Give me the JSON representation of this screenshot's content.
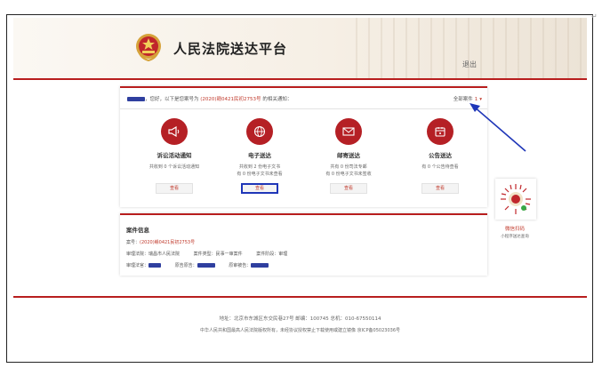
{
  "header": {
    "site_title": "人民法院送达平台",
    "logout_label": "退出"
  },
  "notice": {
    "greeting_suffix": "，您好，以下是您案号为",
    "case_number": "(2020)赣0421民初2753号",
    "notice_suffix": "的相关通知：",
    "total_files_label": "全部案件",
    "total_files_count": "1",
    "dropdown_icon": "caret-down-icon"
  },
  "services": [
    {
      "icon": "megaphone-icon",
      "title": "诉讼活动通知",
      "desc_lines": [
        "共收到 0 个诉讼活动通知"
      ],
      "button": "查看"
    },
    {
      "icon": "globe-icon",
      "title": "电子送达",
      "desc_lines": [
        "共收到 2 份电子文书",
        "有 0 份电子文书未查看"
      ],
      "button": "查看",
      "highlighted": true
    },
    {
      "icon": "mail-icon",
      "title": "邮寄送达",
      "desc_lines": [
        "共有 0 份司法专邮",
        "有 0 份电子文书未签收"
      ],
      "button": "查看"
    },
    {
      "icon": "announcement-icon",
      "title": "公告送达",
      "desc_lines": [
        "有 0 个公告待查看"
      ],
      "button": "查看"
    }
  ],
  "case_info": {
    "title": "案件信息",
    "case_number_label": "案号：",
    "case_number": "(2020)赣0421民初2753号",
    "court": "审理法院：瑞昌市人民法院",
    "cause": "案件类型：民事一审案件",
    "stage": "案件阶段：审理",
    "judge_label": "审理法官：",
    "plaintiff_label": "原告原告：",
    "defendant_label": "原审被告："
  },
  "qr": {
    "title": "微信扫码",
    "subtitle": "小程序送达查询"
  },
  "footer": {
    "address": "地址：北京市东城区东交民巷27号    邮编：100745    总机：010-67550114",
    "copyright": "中华人民共和国最高人民法院版权所有，未经协议授权禁止下载使用或建立镜像  京ICP备05023036号"
  },
  "colors": {
    "accent_red": "#b52025",
    "highlight_blue": "#1f36b8",
    "redaction_blue": "#2f3f9f"
  }
}
